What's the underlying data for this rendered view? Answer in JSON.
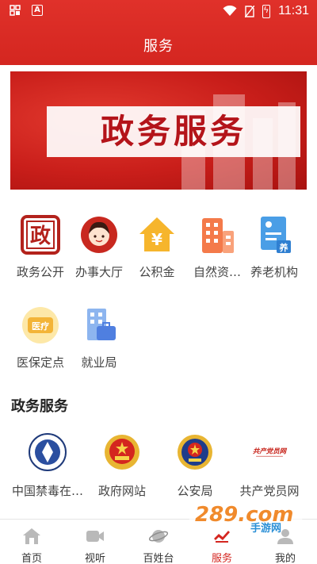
{
  "status_bar": {
    "left_icons": [
      "gallery-icon",
      "a-icon"
    ],
    "a_icon_label": "A",
    "time": "11:31"
  },
  "header": {
    "title": "服务"
  },
  "banner": {
    "text": "政务服务"
  },
  "services": [
    {
      "label": "政务公开",
      "icon": "seal-icon"
    },
    {
      "label": "办事大厅",
      "icon": "person-icon"
    },
    {
      "label": "公积金",
      "icon": "house-yen-icon"
    },
    {
      "label": "自然资…",
      "icon": "building-icon"
    },
    {
      "label": "养老机构",
      "icon": "elderly-card-icon"
    },
    {
      "label": "医保定点",
      "icon": "medical-insurance-icon"
    },
    {
      "label": "就业局",
      "icon": "briefcase-icon"
    }
  ],
  "service_icon_text": {
    "seal": "政",
    "yen": "¥",
    "medical": "医疗",
    "elderly": "养"
  },
  "gov_section": {
    "title": "政务服务",
    "items": [
      {
        "label": "中国禁毒在…",
        "icon": "anti-drug-emblem-icon"
      },
      {
        "label": "政府网站",
        "icon": "national-emblem-icon"
      },
      {
        "label": "公安局",
        "icon": "police-emblem-icon"
      },
      {
        "label": "共产党员网",
        "icon": "party-member-logo-icon",
        "logo_text": "共产党员网"
      }
    ]
  },
  "watermark": {
    "main": "289.com",
    "sub": "手游网"
  },
  "tabbar": {
    "tabs": [
      {
        "label": "首页",
        "icon": "home-icon"
      },
      {
        "label": "视听",
        "icon": "video-icon"
      },
      {
        "label": "百姓台",
        "icon": "planet-icon"
      },
      {
        "label": "服务",
        "icon": "service-icon",
        "active": true
      },
      {
        "label": "我的",
        "icon": "profile-icon"
      }
    ]
  },
  "colors": {
    "primary": "#d42620",
    "active_tab": "#d42620"
  }
}
